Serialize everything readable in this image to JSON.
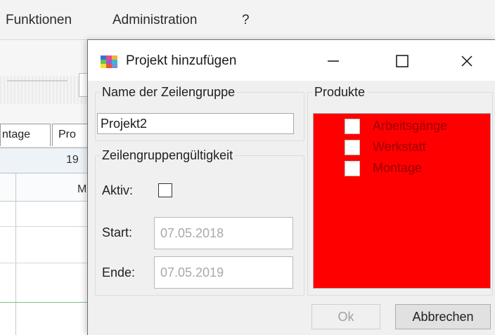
{
  "main_window": {
    "menu": [
      "Funktionen",
      "Administration",
      "?"
    ],
    "tabs": [
      "ntage",
      "Pro"
    ],
    "grid": {
      "header_row1": "19",
      "header_row2": "M"
    }
  },
  "dialog": {
    "title": "Projekt hinzufügen",
    "icon": "colorful-app-icon",
    "window_buttons": {
      "minimize": "minimize-icon",
      "maximize": "maximize-icon",
      "close": "close-icon"
    },
    "name_group": {
      "legend": "Name der Zeilengruppe",
      "value": "Projekt2"
    },
    "validity_group": {
      "legend": "Zeilengruppengültigkeit",
      "active_label": "Aktiv:",
      "active_checked": false,
      "start_label": "Start:",
      "start_value": "07.05.2018",
      "end_label": "Ende:",
      "end_value": "07.05.2019"
    },
    "products_group": {
      "legend": "Produkte",
      "background_color": "#ff0000",
      "items": [
        {
          "label": "Arbeitsgänge",
          "checked": false
        },
        {
          "label": "Werkstatt",
          "checked": false
        },
        {
          "label": "Montage",
          "checked": false
        }
      ]
    },
    "buttons": {
      "ok": "Ok",
      "cancel": "Abbrechen"
    }
  }
}
